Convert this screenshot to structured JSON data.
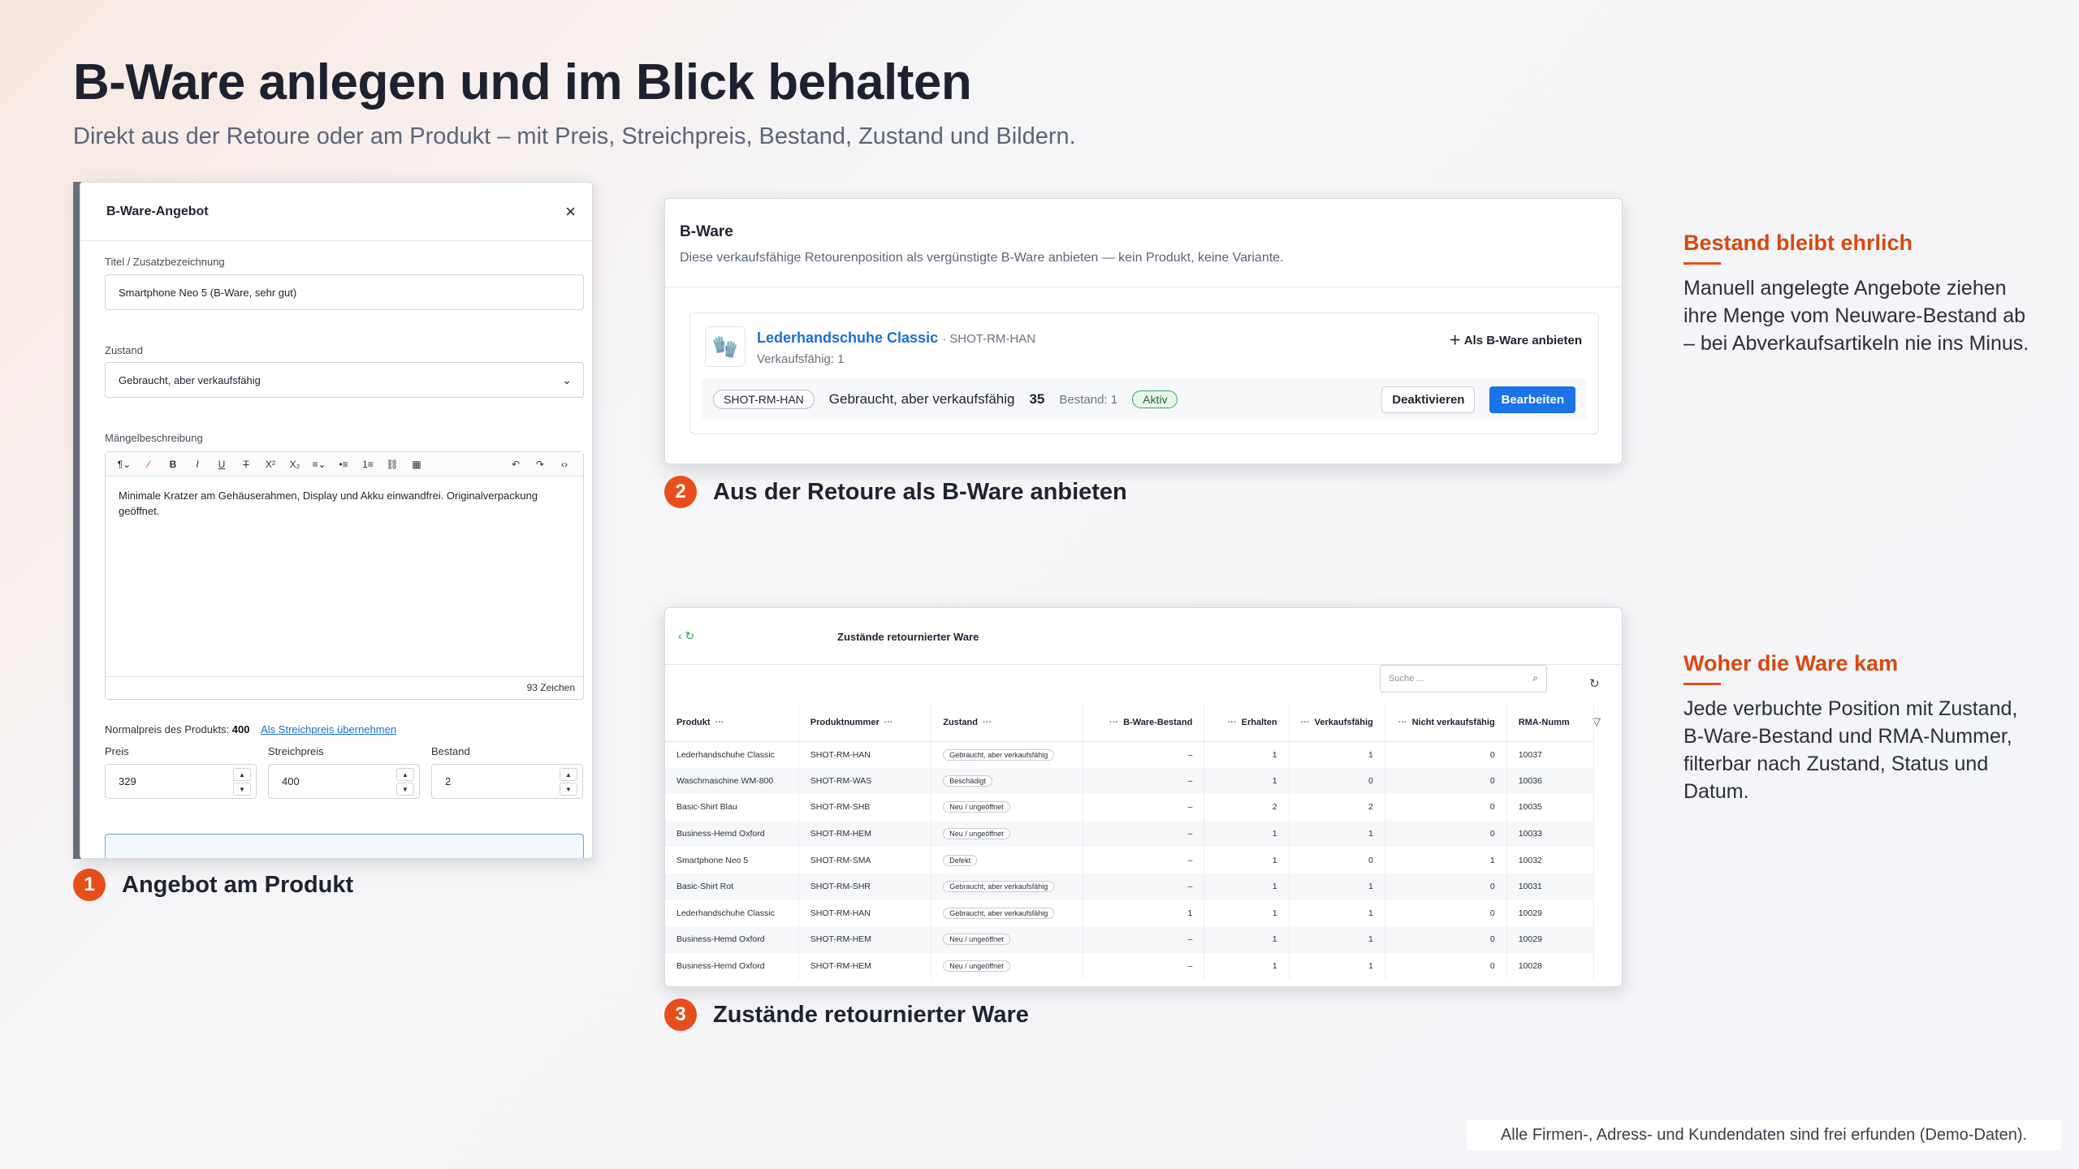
{
  "header": {
    "title": "B-Ware anlegen und im Blick behalten",
    "subtitle": "Direkt aus der Retoure oder am Produkt – mit Preis, Streichpreis, Bestand, Zustand und Bildern."
  },
  "modal": {
    "title": "B-Ware-Angebot",
    "close": "×",
    "title_label": "Titel / Zusatzbezeichnung",
    "title_value": "Smartphone Neo 5 (B-Ware, sehr gut)",
    "condition_label": "Zustand",
    "condition_value": "Gebraucht, aber verkaufsfähig",
    "defects_label": "Mängelbeschreibung",
    "defects_text": "Minimale Kratzer am Gehäuserahmen, Display und Akku einwandfrei. Originalverpackung geöffnet.",
    "char_count": "93 Zeichen",
    "normal_price_text": "Normalpreis des Produkts:",
    "normal_price_value": "400",
    "take_strike_link": "Als Streichpreis übernehmen",
    "price_label": "Preis",
    "price_value": "329",
    "strike_label": "Streichpreis",
    "strike_value": "400",
    "stock_label": "Bestand",
    "stock_value": "2"
  },
  "label1": {
    "num": "1",
    "text": "Angebot am Produkt"
  },
  "card2": {
    "title": "B-Ware",
    "desc": "Diese verkaufsfähige Retourenposition als vergünstigte B-Ware anbieten — kein Produkt, keine Variante.",
    "product": "Lederhandschuhe Classic",
    "sku": "· SHOT-RM-HAN",
    "sellable": "Verkaufsfähig: 1",
    "add": "Als B-Ware anbieten",
    "pill_sku": "SHOT-RM-HAN",
    "condition": "Gebraucht, aber verkaufsfähig",
    "price": "35",
    "stock": "Bestand: 1",
    "status": "Aktiv",
    "deactivate": "Deaktivieren",
    "edit": "Bearbeiten"
  },
  "label2": {
    "num": "2",
    "text": "Aus der Retoure als B-Ware anbieten"
  },
  "card3": {
    "title": "Zustände retournierter Ware",
    "search_placeholder": "Suche ...",
    "columns": [
      "Produkt",
      "Produktnummer",
      "Zustand",
      "B-Ware-Bestand",
      "Erhalten",
      "Verkaufsfähig",
      "Nicht verkaufsfähig",
      "RMA-Numm"
    ],
    "rows": [
      [
        "Lederhandschuhe Classic",
        "SHOT-RM-HAN",
        "Gebraucht, aber verkaufsfähig",
        "–",
        "1",
        "1",
        "0",
        "10037"
      ],
      [
        "Waschmaschine WM-800",
        "SHOT-RM-WAS",
        "Beschädigt",
        "–",
        "1",
        "0",
        "0",
        "10036"
      ],
      [
        "Basic-Shirt Blau",
        "SHOT-RM-SHB",
        "Neu / ungeöffnet",
        "–",
        "2",
        "2",
        "0",
        "10035"
      ],
      [
        "Business-Hemd Oxford",
        "SHOT-RM-HEM",
        "Neu / ungeöffnet",
        "–",
        "1",
        "1",
        "0",
        "10033"
      ],
      [
        "Smartphone Neo 5",
        "SHOT-RM-SMA",
        "Defekt",
        "–",
        "1",
        "0",
        "1",
        "10032"
      ],
      [
        "Basic-Shirt Rot",
        "SHOT-RM-SHR",
        "Gebraucht, aber verkaufsfähig",
        "–",
        "1",
        "1",
        "0",
        "10031"
      ],
      [
        "Lederhandschuhe Classic",
        "SHOT-RM-HAN",
        "Gebraucht, aber verkaufsfähig",
        "1",
        "1",
        "1",
        "0",
        "10029"
      ],
      [
        "Business-Hemd Oxford",
        "SHOT-RM-HEM",
        "Neu / ungeöffnet",
        "–",
        "1",
        "1",
        "0",
        "10029"
      ],
      [
        "Business-Hemd Oxford",
        "SHOT-RM-HEM",
        "Neu / ungeöffnet",
        "–",
        "1",
        "1",
        "0",
        "10028"
      ]
    ]
  },
  "label3": {
    "num": "3",
    "text": "Zustände retournierter Ware"
  },
  "side1": {
    "title": "Bestand bleibt ehrlich",
    "text": "Manuell angelegte Angebote ziehen ihre Menge vom Neuware-Bestand ab – bei Abverkaufsartikeln nie ins Minus."
  },
  "side2": {
    "title": "Woher die Ware kam",
    "text": "Jede verbuchte Position mit Zustand, B-Ware-Bestand und RMA-Nummer, filterbar nach Zustand, Status und Datum."
  },
  "footer": "Alle Firmen-, Adress- und Kundendaten sind frei erfunden (Demo-Daten)."
}
